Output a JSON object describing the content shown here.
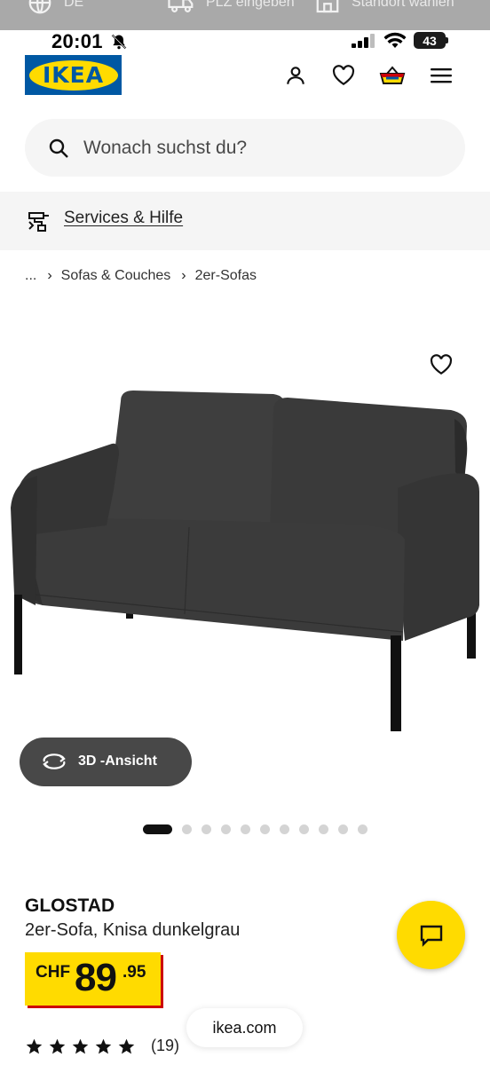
{
  "top_strip": {
    "language_label": "DE",
    "zip_label": "PLZ eingeben",
    "store_label": "Standort wählen"
  },
  "status_bar": {
    "time": "20:01",
    "battery": "43"
  },
  "header": {
    "logo_text": "IKEA"
  },
  "search": {
    "placeholder": "Wonach suchst du?"
  },
  "services": {
    "label": "Services & Hilfe"
  },
  "breadcrumb": {
    "items": [
      "...",
      "Sofas & Couches",
      "2er-Sofas"
    ]
  },
  "gallery": {
    "view3d_label": "3D -Ansicht",
    "image_count": 11,
    "active_index": 0
  },
  "product": {
    "name": "GLOSTAD",
    "description": "2er-Sofa, Knisa dunkelgrau",
    "price_currency": "CHF",
    "price_integer": "89",
    "price_decimal": ".95",
    "rating_value": 5,
    "rating_count": "(19)"
  },
  "browser": {
    "url": "ikea.com"
  },
  "colors": {
    "ikea_blue": "#0058a3",
    "ikea_yellow": "#ffdb00",
    "price_shadow_red": "#cc0008",
    "sofa_gray": "#3a3a3a"
  }
}
